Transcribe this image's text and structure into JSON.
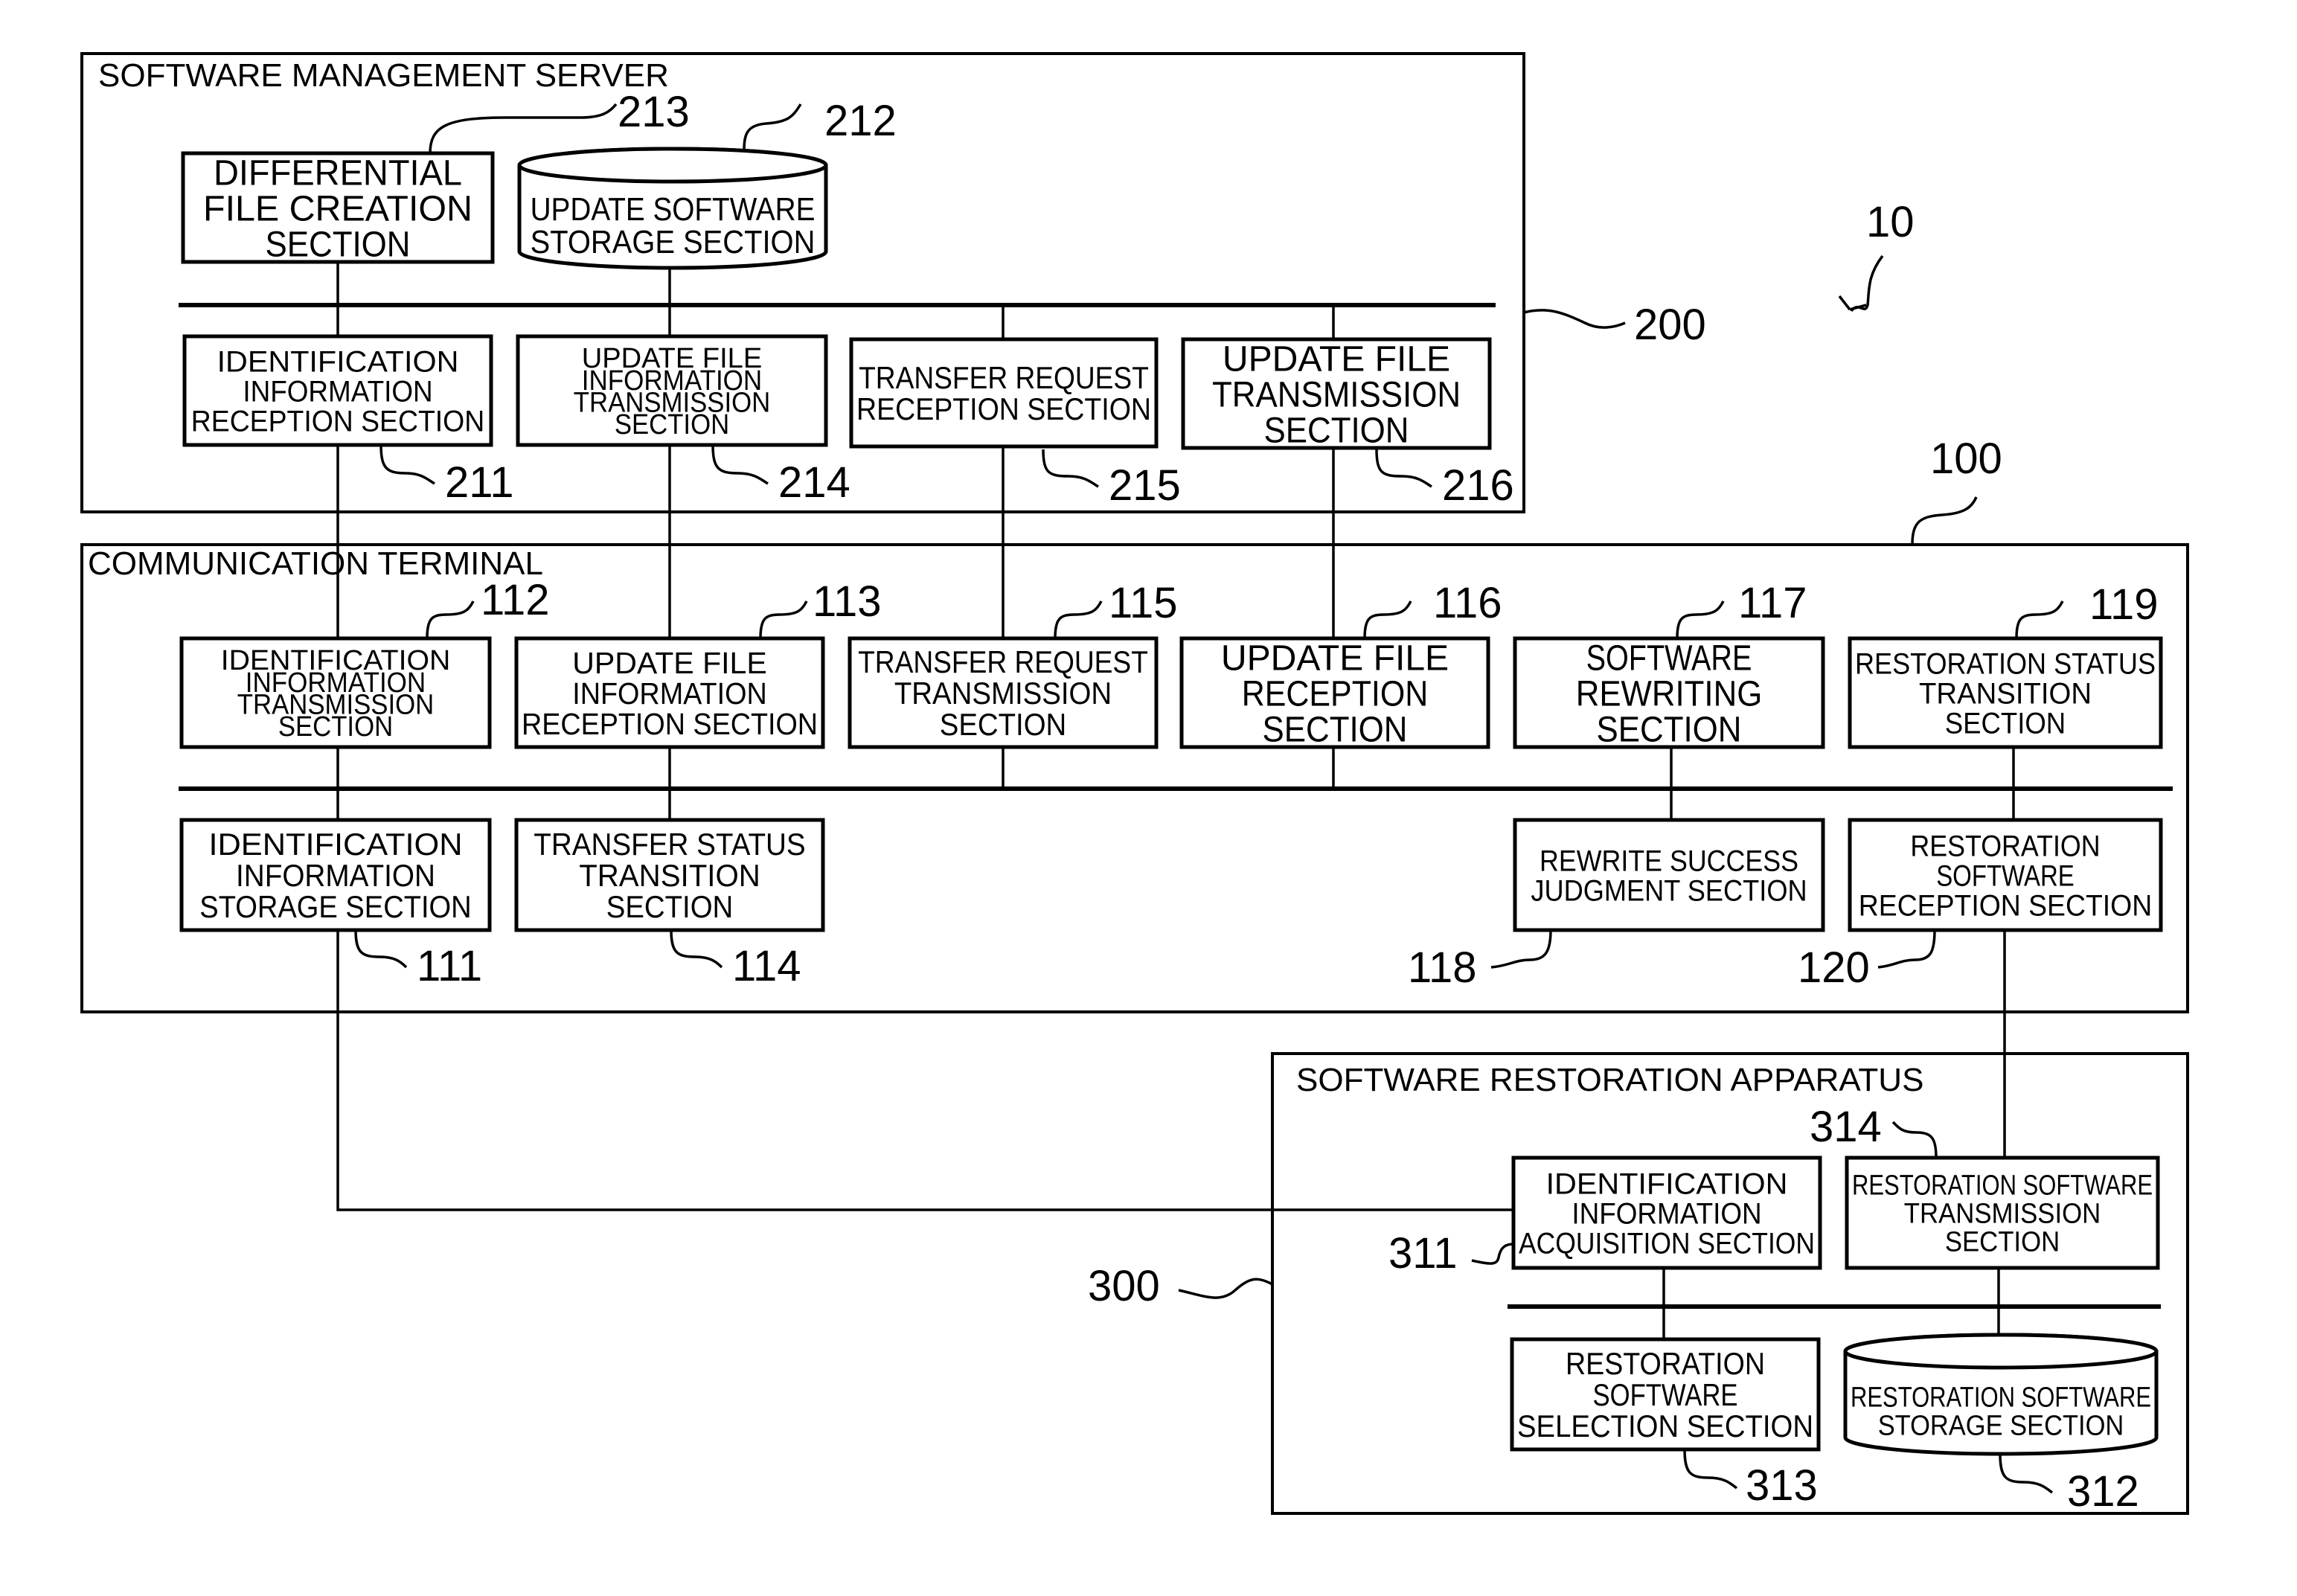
{
  "figure_ref": "10",
  "groups": {
    "server": {
      "label": "SOFTWARE MANAGEMENT SERVER",
      "ref": "200",
      "blocks": [
        {
          "id": "213",
          "lines": [
            "DIFFERENTIAL",
            "FILE CREATION",
            "SECTION"
          ],
          "shape": "rect"
        },
        {
          "id": "212",
          "lines": [
            "UPDATE SOFTWARE",
            "STORAGE SECTION"
          ],
          "shape": "cylinder"
        },
        {
          "id": "211",
          "lines": [
            "IDENTIFICATION",
            "INFORMATION",
            "RECEPTION SECTION"
          ],
          "shape": "rect"
        },
        {
          "id": "214",
          "lines": [
            "UPDATE FILE",
            "INFORMATION",
            "TRANSMISSION",
            "SECTION"
          ],
          "shape": "rect"
        },
        {
          "id": "215",
          "lines": [
            "TRANSFER REQUEST",
            "RECEPTION SECTION"
          ],
          "shape": "rect"
        },
        {
          "id": "216",
          "lines": [
            "UPDATE FILE",
            "TRANSMISSION",
            "SECTION"
          ],
          "shape": "rect"
        }
      ]
    },
    "terminal": {
      "label": "COMMUNICATION TERMINAL",
      "ref": "100",
      "blocks": [
        {
          "id": "112",
          "lines": [
            "IDENTIFICATION",
            "INFORMATION",
            "TRANSMISSION",
            "SECTION"
          ],
          "shape": "rect"
        },
        {
          "id": "113",
          "lines": [
            "UPDATE FILE",
            "INFORMATION",
            "RECEPTION SECTION"
          ],
          "shape": "rect"
        },
        {
          "id": "115",
          "lines": [
            "TRANSFER REQUEST",
            "TRANSMISSION",
            "SECTION"
          ],
          "shape": "rect"
        },
        {
          "id": "116",
          "lines": [
            "UPDATE FILE",
            "RECEPTION",
            "SECTION"
          ],
          "shape": "rect"
        },
        {
          "id": "117",
          "lines": [
            "SOFTWARE",
            "REWRITING",
            "SECTION"
          ],
          "shape": "rect"
        },
        {
          "id": "119",
          "lines": [
            "RESTORATION STATUS",
            "TRANSITION",
            "SECTION"
          ],
          "shape": "rect"
        },
        {
          "id": "111",
          "lines": [
            "IDENTIFICATION",
            "INFORMATION",
            "STORAGE SECTION"
          ],
          "shape": "rect"
        },
        {
          "id": "114",
          "lines": [
            "TRANSFER STATUS",
            "TRANSITION",
            "SECTION"
          ],
          "shape": "rect"
        },
        {
          "id": "118",
          "lines": [
            "REWRITE SUCCESS",
            "JUDGMENT SECTION"
          ],
          "shape": "rect"
        },
        {
          "id": "120",
          "lines": [
            "RESTORATION",
            "SOFTWARE",
            "RECEPTION SECTION"
          ],
          "shape": "rect"
        }
      ]
    },
    "restoration": {
      "label": "SOFTWARE RESTORATION APPARATUS",
      "ref": "300",
      "blocks": [
        {
          "id": "311",
          "lines": [
            "IDENTIFICATION",
            "INFORMATION",
            "ACQUISITION SECTION"
          ],
          "shape": "rect"
        },
        {
          "id": "314",
          "lines": [
            "RESTORATION SOFTWARE",
            "TRANSMISSION",
            "SECTION"
          ],
          "shape": "rect"
        },
        {
          "id": "313",
          "lines": [
            "RESTORATION",
            "SOFTWARE",
            "SELECTION SECTION"
          ],
          "shape": "rect"
        },
        {
          "id": "312",
          "lines": [
            "RESTORATION SOFTWARE",
            "STORAGE SECTION"
          ],
          "shape": "cylinder"
        }
      ]
    }
  }
}
